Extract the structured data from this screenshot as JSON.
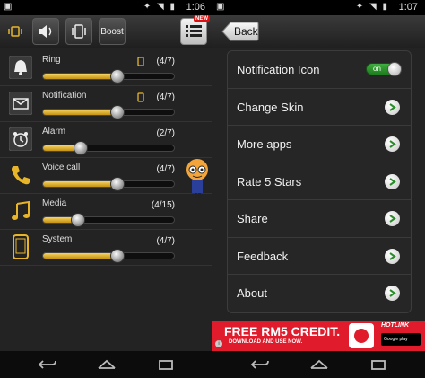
{
  "left": {
    "status": {
      "time": "1:06"
    },
    "toolbar": {
      "boost_label": "Boost"
    },
    "volumes": [
      {
        "label": "Ring",
        "count": "(4/7)",
        "level": 0.571,
        "icon": "bell-icon",
        "device_icon": true
      },
      {
        "label": "Notification",
        "count": "(4/7)",
        "level": 0.571,
        "icon": "envelope-icon",
        "device_icon": true
      },
      {
        "label": "Alarm",
        "count": "(2/7)",
        "level": 0.286,
        "icon": "alarm-clock-icon",
        "device_icon": false
      },
      {
        "label": "Voice call",
        "count": "(4/7)",
        "level": 0.571,
        "icon": "phone-icon",
        "device_icon": false
      },
      {
        "label": "Media",
        "count": "(4/15)",
        "level": 0.267,
        "icon": "music-note-icon",
        "device_icon": false
      },
      {
        "label": "System",
        "count": "(4/7)",
        "level": 0.571,
        "icon": "phone-device-icon",
        "device_icon": false
      }
    ]
  },
  "right": {
    "status": {
      "time": "1:07"
    },
    "toolbar": {
      "back_label": "Back",
      "new_badge": "NEW"
    },
    "settings": [
      {
        "label": "Notification Icon",
        "control": "toggle",
        "toggle_label": "on"
      },
      {
        "label": "Change Skin",
        "control": "arrow"
      },
      {
        "label": "More apps",
        "control": "arrow"
      },
      {
        "label": "Rate 5 Stars",
        "control": "arrow"
      },
      {
        "label": "Share",
        "control": "arrow"
      },
      {
        "label": "Feedback",
        "control": "arrow"
      },
      {
        "label": "About",
        "control": "arrow"
      }
    ],
    "ad": {
      "headline": "FREE RM5 CREDIT.",
      "subline": "DOWNLOAD AND USE NOW.",
      "brand": "HOTLINK",
      "store": "Google play"
    }
  },
  "colors": {
    "accent_gold": "#e8b52a",
    "toggle_green": "#2e8f2e",
    "ad_red": "#e01b2b"
  }
}
